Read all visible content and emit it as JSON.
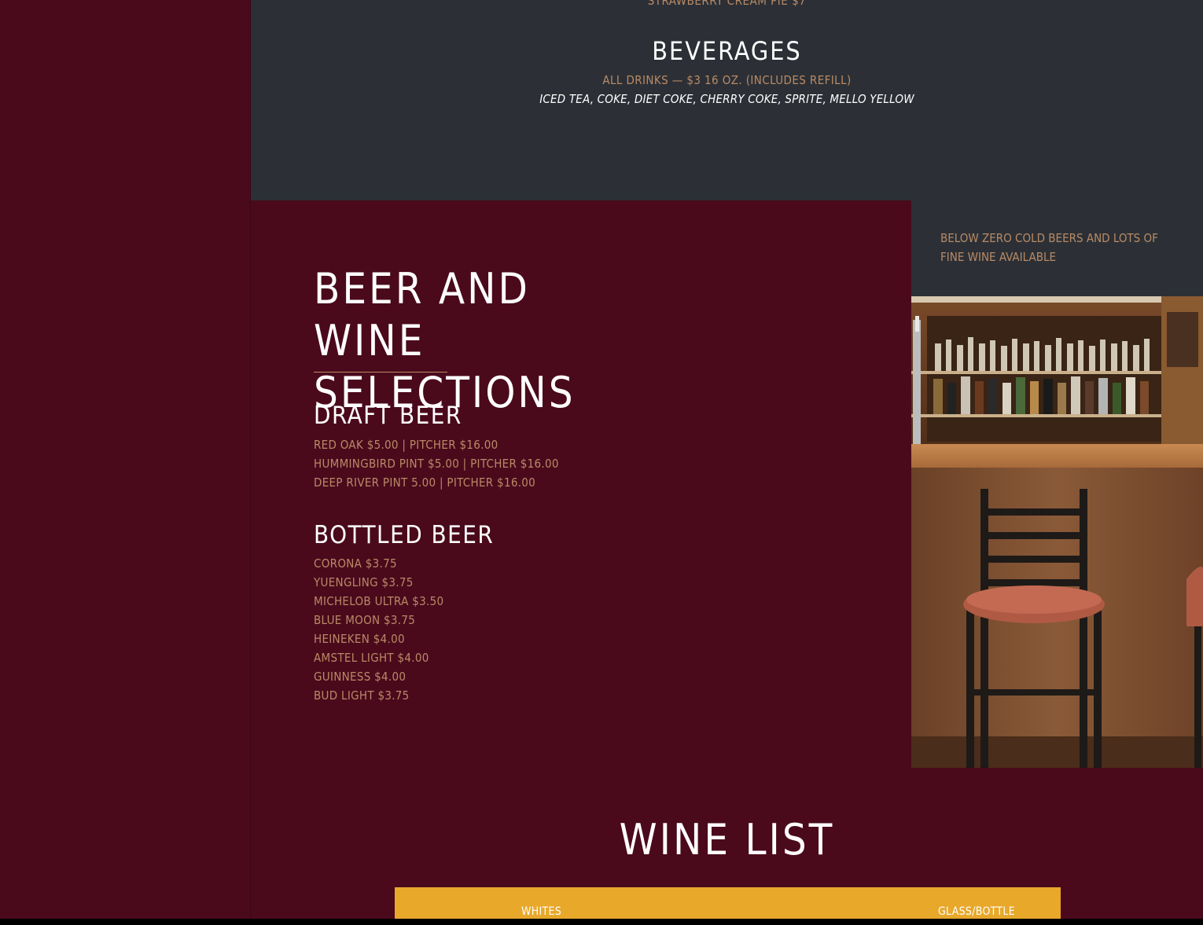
{
  "beverages": {
    "previous_item": "STRAWBERRY CREAM PIE $7",
    "title": "BEVERAGES",
    "price_line": "ALL DRINKS — $3 16 OZ. (INCLUDES REFILL)",
    "drinks_line": "ICED TEA, COKE, DIET COKE, CHERRY COKE, SPRITE, MELLO YELLOW"
  },
  "beer_wine": {
    "heading_line1": "BEER AND WINE",
    "heading_line2": "SELECTIONS",
    "draft": {
      "title": "DRAFT BEER",
      "items": [
        "RED OAK $5.00 | PITCHER $16.00",
        "HUMMINGBIRD PINT $5.00 | PITCHER $16.00",
        "DEEP RIVER PINT 5.00 | PITCHER $16.00"
      ]
    },
    "bottled": {
      "title": "BOTTLED BEER",
      "items": [
        "CORONA $3.75",
        "YUENGLING $3.75",
        "MICHELOB ULTRA $3.50",
        "BLUE MOON $3.75",
        "HEINEKEN $4.00",
        "AMSTEL LIGHT $4.00",
        "GUINNESS $4.00",
        "BUD LIGHT $3.75"
      ]
    }
  },
  "promo": {
    "text": "BELOW ZERO COLD BEERS AND LOTS OF FINE WINE AVAILABLE"
  },
  "wine_list": {
    "title": "WINE LIST",
    "columns": [
      "WHITES",
      "GLASS/BOTTLE"
    ]
  },
  "colors": {
    "burgundy": "#4a0a1c",
    "slate": "#2c3036",
    "tan_text": "#b98a66",
    "gold": "#e8a82a"
  }
}
